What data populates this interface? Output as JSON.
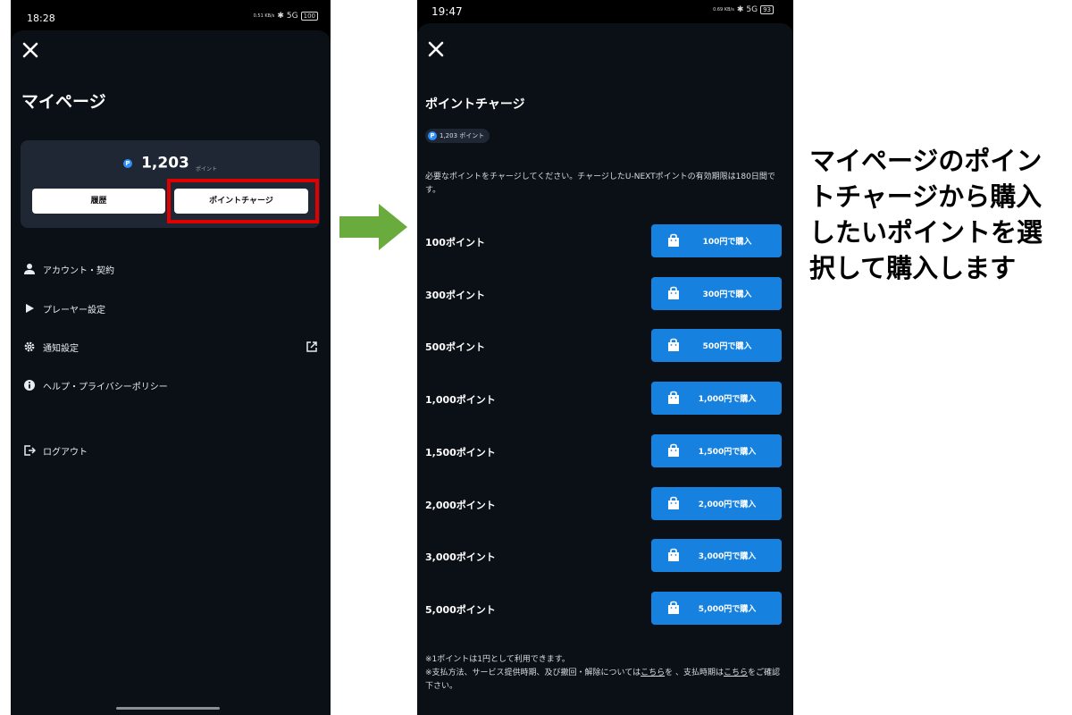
{
  "left_screen": {
    "status": {
      "time": "18:28",
      "speed": "0.51 KB/s",
      "network": "5G",
      "battery": "100"
    },
    "page_title": "マイページ",
    "points": {
      "value": "1,203",
      "unit": "ポイント"
    },
    "buttons": {
      "history": "履歴",
      "charge": "ポイントチャージ"
    },
    "menu": [
      {
        "label": "アカウント・契約",
        "icon": "person-icon"
      },
      {
        "label": "プレーヤー設定",
        "icon": "play-icon"
      },
      {
        "label": "通知設定",
        "icon": "gear-icon",
        "external": true
      },
      {
        "label": "ヘルプ・プライバシーポリシー",
        "icon": "info-icon"
      }
    ],
    "logout": {
      "label": "ログアウト",
      "icon": "logout-icon"
    }
  },
  "right_screen": {
    "status": {
      "time": "19:47",
      "speed": "0.69 KB/s",
      "network": "5G",
      "battery": "93"
    },
    "page_title": "ポイントチャージ",
    "points_badge": "1,203 ポイント",
    "description": "必要なポイントをチャージしてください。チャージしたU-NEXTポイントの有効期限は180日間です。",
    "plans": [
      {
        "label": "100ポイント",
        "button": "100円で購入"
      },
      {
        "label": "300ポイント",
        "button": "300円で購入"
      },
      {
        "label": "500ポイント",
        "button": "500円で購入"
      },
      {
        "label": "1,000ポイント",
        "button": "1,000円で購入"
      },
      {
        "label": "1,500ポイント",
        "button": "1,500円で購入"
      },
      {
        "label": "2,000ポイント",
        "button": "2,000円で購入"
      },
      {
        "label": "3,000ポイント",
        "button": "3,000円で購入"
      },
      {
        "label": "5,000ポイント",
        "button": "5,000円で購入"
      }
    ],
    "notes": {
      "line1": "※1ポイントは1円として利用できます。",
      "line2_pre": "※支払方法、サービス提供時期、及び撤回・解除については",
      "link1": "こちら",
      "line2_mid": "を 、支払時期は",
      "link2": "こちら",
      "line2_post": "をご確認下さい。"
    }
  },
  "caption": "マイページのポイントチャージから購入したいポイントを選択して購入します",
  "colors": {
    "highlight": "#e00000",
    "arrow": "#6aab3e",
    "accent": "#1781e0",
    "card": "#1e2733"
  }
}
